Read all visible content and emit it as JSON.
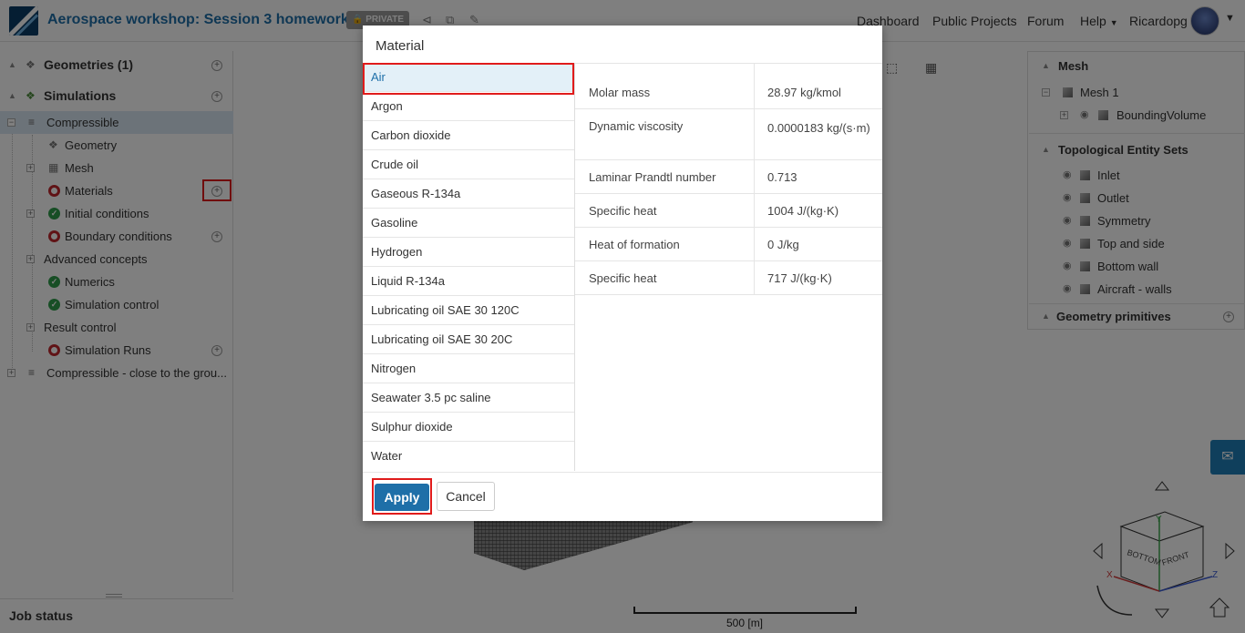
{
  "header": {
    "title": "Aerospace workshop: Session 3 homework",
    "badge": "PRIVATE",
    "nav": [
      "Dashboard",
      "Public Projects",
      "Forum",
      "Help",
      "Ricardopg"
    ]
  },
  "left_panel": {
    "geometries_label": "Geometries (1)",
    "simulations_label": "Simulations",
    "items": [
      {
        "label": "Compressible"
      },
      {
        "label": "Geometry"
      },
      {
        "label": "Mesh"
      },
      {
        "label": "Materials"
      },
      {
        "label": "Initial conditions"
      },
      {
        "label": "Boundary conditions"
      },
      {
        "label": "Advanced concepts"
      },
      {
        "label": "Numerics"
      },
      {
        "label": "Simulation control"
      },
      {
        "label": "Result control"
      },
      {
        "label": "Simulation Runs"
      },
      {
        "label": "Compressible - close to the grou..."
      }
    ],
    "job_status": "Job status"
  },
  "right_panel": {
    "mesh_title": "Mesh",
    "mesh1": "Mesh 1",
    "bounding": "BoundingVolume",
    "topo_title": "Topological Entity Sets",
    "topo_items": [
      "Inlet",
      "Outlet",
      "Symmetry",
      "Top and side",
      "Bottom wall",
      "Aircraft - walls"
    ],
    "geo_prims": "Geometry primitives"
  },
  "viewport": {
    "scale_label": "500 [m]",
    "cube_faces": {
      "top": "Y",
      "front": "FRONT",
      "bottom": "BOTTOM",
      "x": "X",
      "z": "Z"
    }
  },
  "modal": {
    "title": "Material",
    "materials": [
      "Air",
      "Argon",
      "Carbon dioxide",
      "Crude oil",
      "Gaseous R-134a",
      "Gasoline",
      "Hydrogen",
      "Liquid R-134a",
      "Lubricating oil SAE 30 120C",
      "Lubricating oil SAE 30 20C",
      "Nitrogen",
      "Seawater 3.5 pc saline",
      "Sulphur dioxide",
      "Water"
    ],
    "selected": "Air",
    "properties": [
      {
        "name": "Molar mass",
        "value": "28.97 kg/kmol"
      },
      {
        "name": "Dynamic viscosity",
        "value": "0.0000183 kg/(s·m)"
      },
      {
        "name": "Laminar Prandtl number",
        "value": "0.713"
      },
      {
        "name": "Specific heat",
        "value": "1004 J/(kg·K)"
      },
      {
        "name": "Heat of formation",
        "value": "0 J/kg"
      },
      {
        "name": "Specific heat",
        "value": "717 J/(kg·K)"
      }
    ],
    "apply_label": "Apply",
    "cancel_label": "Cancel"
  },
  "colors": {
    "accent": "#1e6fa8",
    "highlight": "#e01b1b",
    "ok": "#2e9c4a",
    "error": "#c0272d"
  }
}
